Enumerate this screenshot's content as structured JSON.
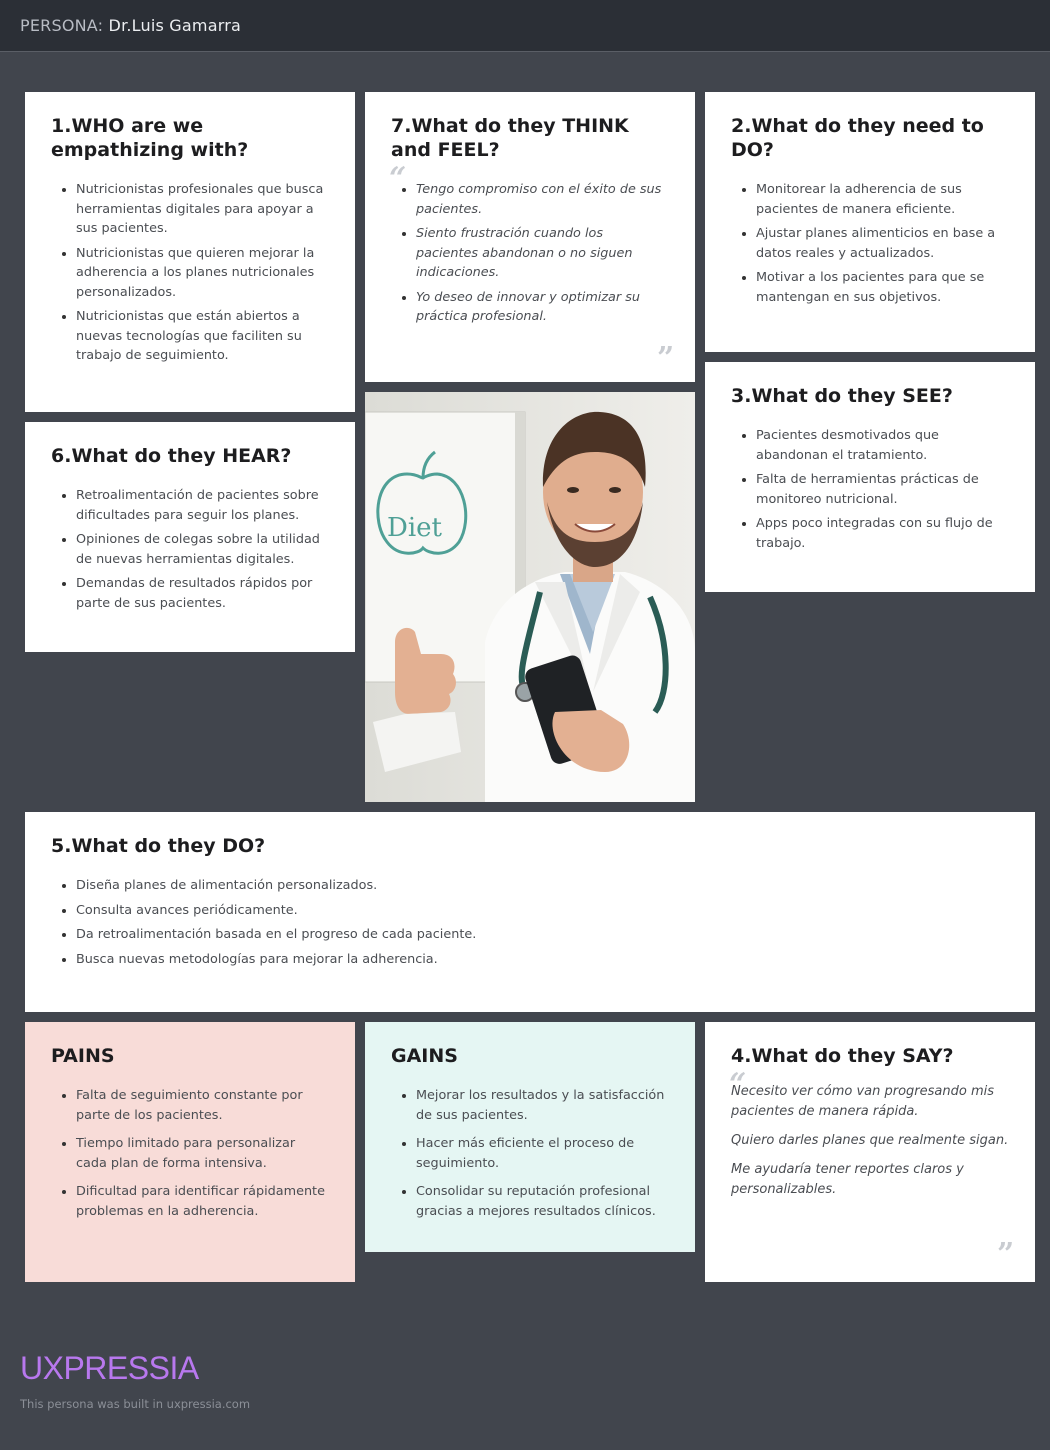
{
  "header": {
    "persona_label": "PERSONA:",
    "persona_name": "Dr.Luis Gamarra"
  },
  "who": {
    "title": "1.WHO are we empathizing with?",
    "items": [
      "Nutricionistas profesionales que busca herramientas digitales para apoyar a sus pacientes.",
      "Nutricionistas que quieren mejorar la adherencia a los planes nutricionales personalizados.",
      "Nutricionistas que están abiertos a nuevas tecnologías que faciliten su trabajo de seguimiento."
    ]
  },
  "think_feel": {
    "title": "7.What do they THINK and FEEL?",
    "items": [
      "Tengo compromiso con el éxito de sus pacientes.",
      "Siento frustración cuando los pacientes abandonan o no siguen indicaciones.",
      "Yo deseo de innovar y optimizar su práctica profesional."
    ]
  },
  "need_to_do": {
    "title": "2.What do they need to DO?",
    "items": [
      "Monitorear la adherencia de sus pacientes de manera eficiente.",
      "Ajustar planes alimenticios en base a datos reales y actualizados.",
      "Motivar a los pacientes para que se mantengan en sus objetivos."
    ]
  },
  "hear": {
    "title": "6.What do they HEAR?",
    "items": [
      "Retroalimentación de pacientes sobre dificultades para seguir los planes.",
      "Opiniones de colegas sobre la utilidad de nuevas herramientas digitales.",
      "Demandas de resultados rápidos por parte de sus pacientes."
    ]
  },
  "see": {
    "title": "3.What do they SEE?",
    "items": [
      "Pacientes desmotivados que abandonan el tratamiento.",
      "Falta de herramientas prácticas de monitoreo nutricional.",
      "Apps poco integradas con su flujo de trabajo."
    ]
  },
  "photo": {
    "board_text": "Diet"
  },
  "do": {
    "title": "5.What do they DO?",
    "items": [
      "Diseña planes de alimentación personalizados.",
      "Consulta avances periódicamente.",
      "Da retroalimentación basada en el progreso de cada paciente.",
      "Busca nuevas metodologías para mejorar la adherencia."
    ]
  },
  "pains": {
    "title": "PAINS",
    "items": [
      "Falta de seguimiento constante por parte de los pacientes.",
      "Tiempo limitado para personalizar cada plan de forma intensiva.",
      "Dificultad para identificar rápidamente problemas en la adherencia."
    ]
  },
  "gains": {
    "title": "GAINS",
    "items": [
      "Mejorar los resultados y la satisfacción de sus pacientes.",
      "Hacer más eficiente el proceso de seguimiento.",
      "Consolidar su reputación profesional gracias a mejores resultados clínicos."
    ]
  },
  "say": {
    "title": "4.What do they SAY?",
    "quotes": [
      "Necesito ver cómo van progresando mis pacientes de manera rápida.",
      "Quiero darles planes que realmente sigan.",
      "Me ayudaría tener reportes claros y personalizables."
    ]
  },
  "footer": {
    "brand": "UXPRESSIA",
    "note": "This persona was built in uxpressia.com"
  },
  "colors": {
    "background": "#41454d",
    "topbar": "#2b2f36",
    "pains_bg": "#f8dcd8",
    "gains_bg": "#e5f6f3",
    "brand": "#b878ee"
  }
}
